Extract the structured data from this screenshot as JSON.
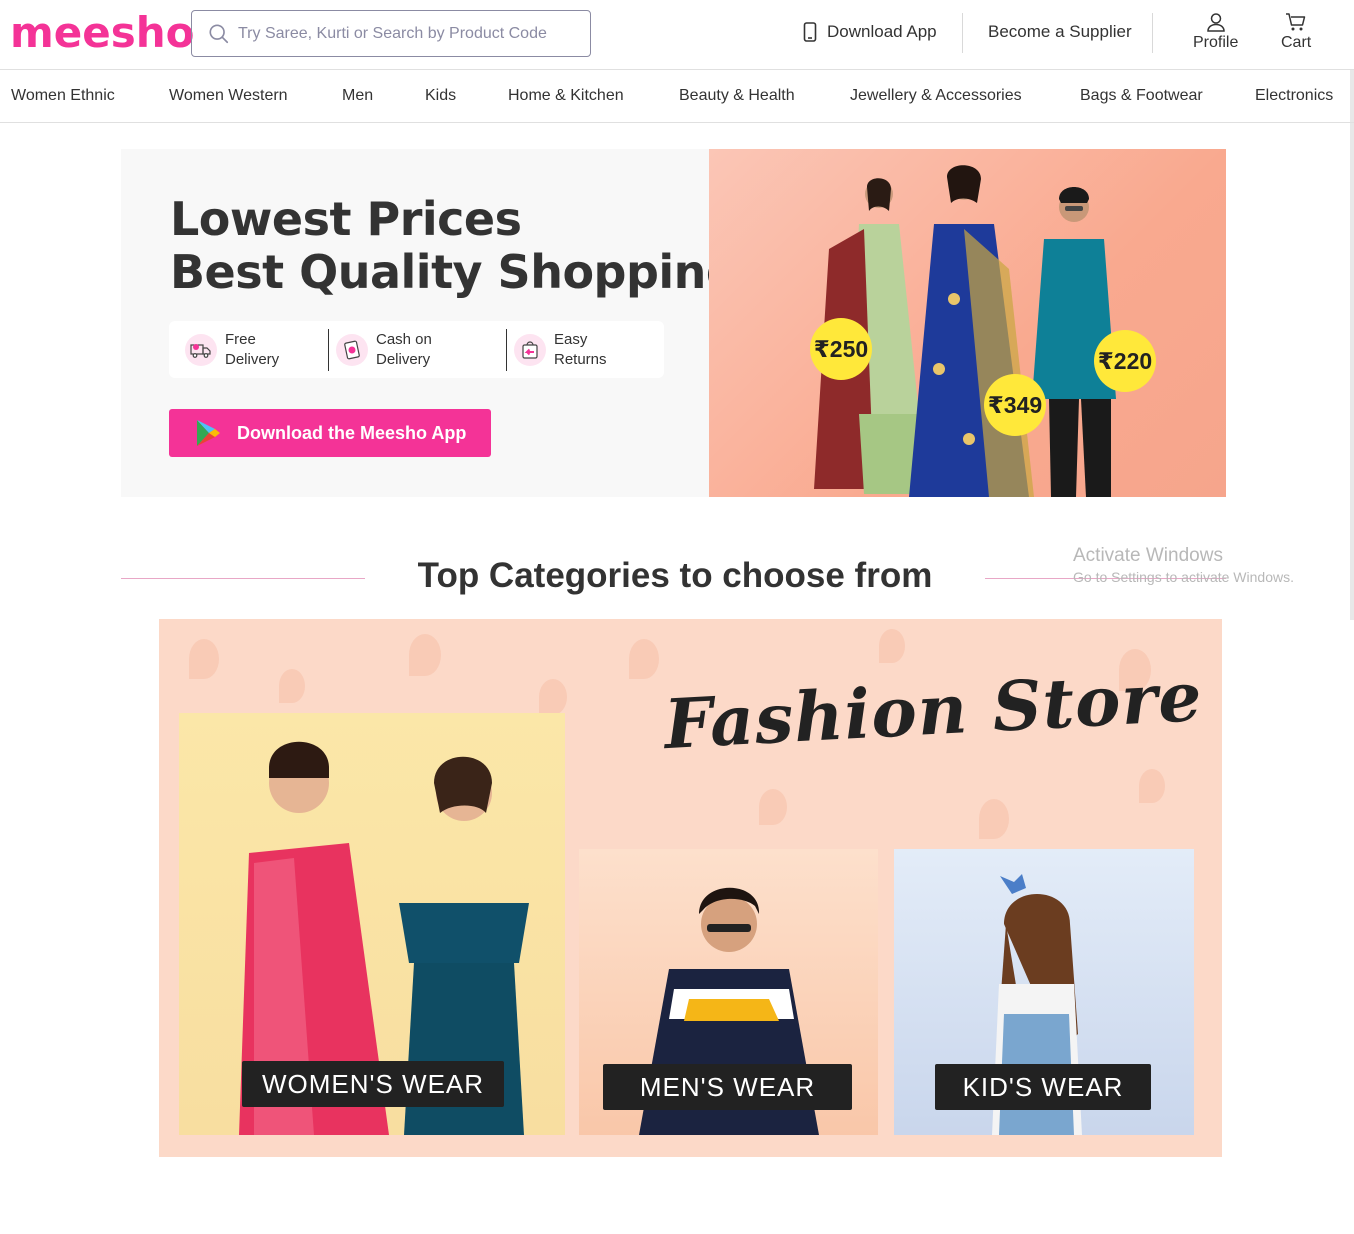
{
  "header": {
    "logo": "meesho",
    "search_placeholder": "Try Saree, Kurti or Search by Product Code",
    "download_app": "Download App",
    "become_supplier": "Become a Supplier",
    "profile": "Profile",
    "cart": "Cart"
  },
  "nav": {
    "items": [
      "Women Ethnic",
      "Women Western",
      "Men",
      "Kids",
      "Home & Kitchen",
      "Beauty & Health",
      "Jewellery & Accessories",
      "Bags & Footwear",
      "Electronics"
    ]
  },
  "hero": {
    "title_line1": "Lowest Prices",
    "title_line2": "Best Quality Shopping",
    "features": [
      {
        "line1": "Free",
        "line2": "Delivery",
        "icon": "truck-icon"
      },
      {
        "line1": "Cash on",
        "line2": "Delivery",
        "icon": "cash-icon"
      },
      {
        "line1": "Easy",
        "line2": "Returns",
        "icon": "return-bag-icon"
      }
    ],
    "download_button": "Download the Meesho App",
    "prices": [
      "₹250",
      "₹349",
      "₹220"
    ]
  },
  "section": {
    "title": "Top Categories to choose from"
  },
  "fashion_store": {
    "title": "Fashion Store",
    "cards": [
      "WOMEN'S WEAR",
      "MEN'S WEAR",
      "KID'S WEAR"
    ]
  },
  "watermark": {
    "line1": "Activate Windows",
    "line2": "Go to Settings to activate Windows."
  },
  "colors": {
    "brand": "#f43397",
    "price_tag": "#ffe83a"
  }
}
